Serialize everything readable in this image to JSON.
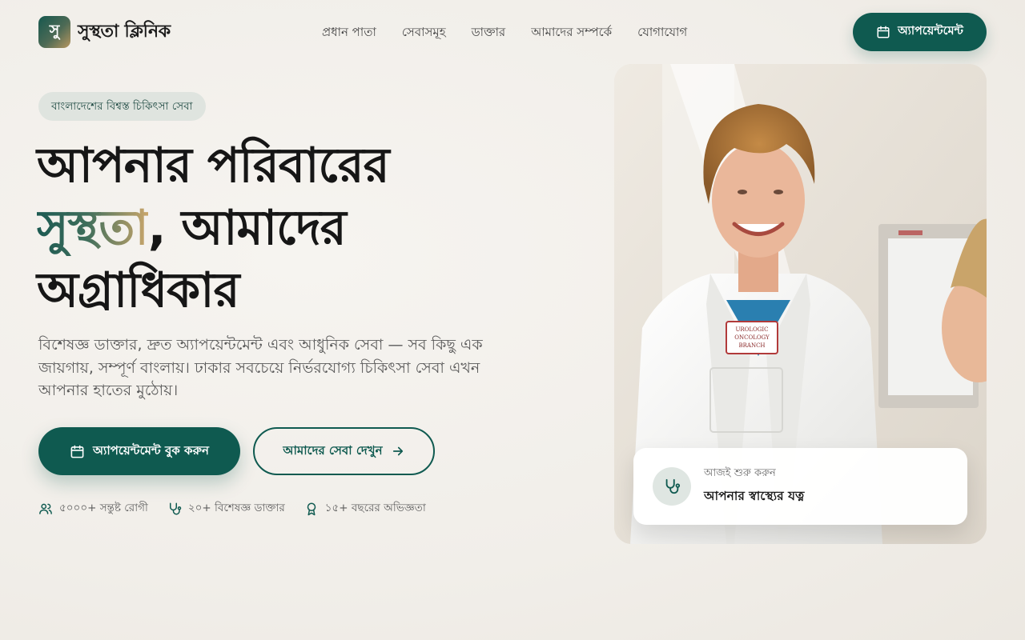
{
  "brand": {
    "mark": "সু",
    "name": "সুস্থতা ক্লিনিক"
  },
  "nav": {
    "items": [
      {
        "label": "প্রধান পাতা"
      },
      {
        "label": "সেবাসমূহ"
      },
      {
        "label": "ডাক্তার"
      },
      {
        "label": "আমাদের সম্পর্কে"
      },
      {
        "label": "যোগাযোগ"
      }
    ],
    "cta_label": "অ্যাপয়েন্টমেন্ট"
  },
  "hero": {
    "badge": "বাংলাদেশের বিশ্বস্ত চিকিৎসা সেবা",
    "headline": {
      "line1": "আপনার পরিবারের",
      "accent": "সুস্থতা",
      "line2_rest": ", আমাদের",
      "line3": "অগ্রাধিকার"
    },
    "lead": "বিশেষজ্ঞ ডাক্তার, দ্রুত অ্যাপয়েন্টমেন্ট এবং আধুনিক সেবা — সব কিছু এক জায়গায়, সম্পূর্ণ বাংলায়। ঢাকার সবচেয়ে নির্ভরযোগ্য চিকিৎসা সেবা এখন আপনার হাতের মুঠোয়।",
    "primary_cta": "অ্যাপয়েন্টমেন্ট বুক করুন",
    "secondary_cta": "আমাদের সেবা দেখুন",
    "stats": [
      {
        "icon": "users-icon",
        "text": "৫০০০+ সন্তুষ্ট রোগী"
      },
      {
        "icon": "stethoscope-icon",
        "text": "২০+ বিশেষজ্ঞ ডাক্তার"
      },
      {
        "icon": "award-icon",
        "text": "১৫+ বছরের অভিজ্ঞতা"
      }
    ]
  },
  "image_card": {
    "icon": "stethoscope-icon",
    "subtitle": "আজই শুরু করুন",
    "title": "আপনার স্বাস্থ্যের যত্ন"
  },
  "photo_badge": {
    "line1": "UROLOGIC",
    "line2": "ONCOLOGY",
    "line3": "BRANCH"
  },
  "colors": {
    "primary": "#0f5a50",
    "accent_gold": "#c9a66b",
    "background": "#f3f0eb"
  }
}
